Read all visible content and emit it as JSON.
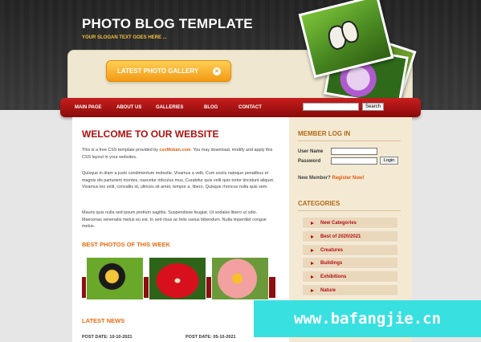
{
  "header": {
    "title": "PHOTO BLOG TEMPLATE",
    "slogan": "YOUR SLOGAN TEXT GOES HERE ..."
  },
  "banner": {
    "gallery_button": "LATEST PHOTO GALLERY"
  },
  "nav": {
    "items": [
      "MAIN PAGE",
      "ABOUT US",
      "GALLERIES",
      "BLOG",
      "CONTACT"
    ],
    "search_button": "Search",
    "search_placeholder": ""
  },
  "main": {
    "welcome_title": "WELCOME TO OUR WEBSITE",
    "intro_before": "This is a free CSS template provided by ",
    "intro_link": "cssMoban.com",
    "intro_after": ". You may download, modify and apply this CSS layout in your websites.",
    "para2": "Quisque in diam a justo condimentum molestie. Vivamus a velit. Cum sociis natoque penatibus et magnis dis parturient montes, nascetur ridiculus mus. Curabitur quis velit quis tortor tincidunt aliquet. Vivamus leo velit, convallis id, ultrices sit amet, tempor a, libero. Quisque rhoncus nulla quis sem.",
    "para3": "Mauris quis nulla sed ipsum pretium sagittis. Suspendisse feugiat. Ut sodales libero ut odio. Maecenas venenatis metus eu est. In sed risus ac felis varius bibendum. Nulla imperdiet congue metus.",
    "best_photos_title": "BEST PHOTOS OF THIS WEEK",
    "latest_news_title": "LATEST NEWS",
    "news_dates": [
      "POST DATE: 10-10-2021",
      "POST DATE: 05-10-2021"
    ]
  },
  "sidebar": {
    "login_title": "MEMBER LOG IN",
    "username_label": "User Name",
    "password_label": "Password",
    "login_button": "Login",
    "new_member_text": "New Member?",
    "register_link": "Register Now!",
    "categories_title": "CATEGORIES",
    "categories": [
      "New Categories",
      "Best of 2020/2021",
      "Creatures",
      "Buildings",
      "Exhibitions",
      "Nature"
    ]
  },
  "watermark": "www.bafangjie.cn",
  "colors": {
    "nav_red": "#b01414",
    "title_red": "#b00e0e",
    "accent_orange": "#e96a0e",
    "button_orange": "#f39a15",
    "sidebar_bg": "#f4ead4",
    "watermark_cyan": "#38e0e0"
  }
}
